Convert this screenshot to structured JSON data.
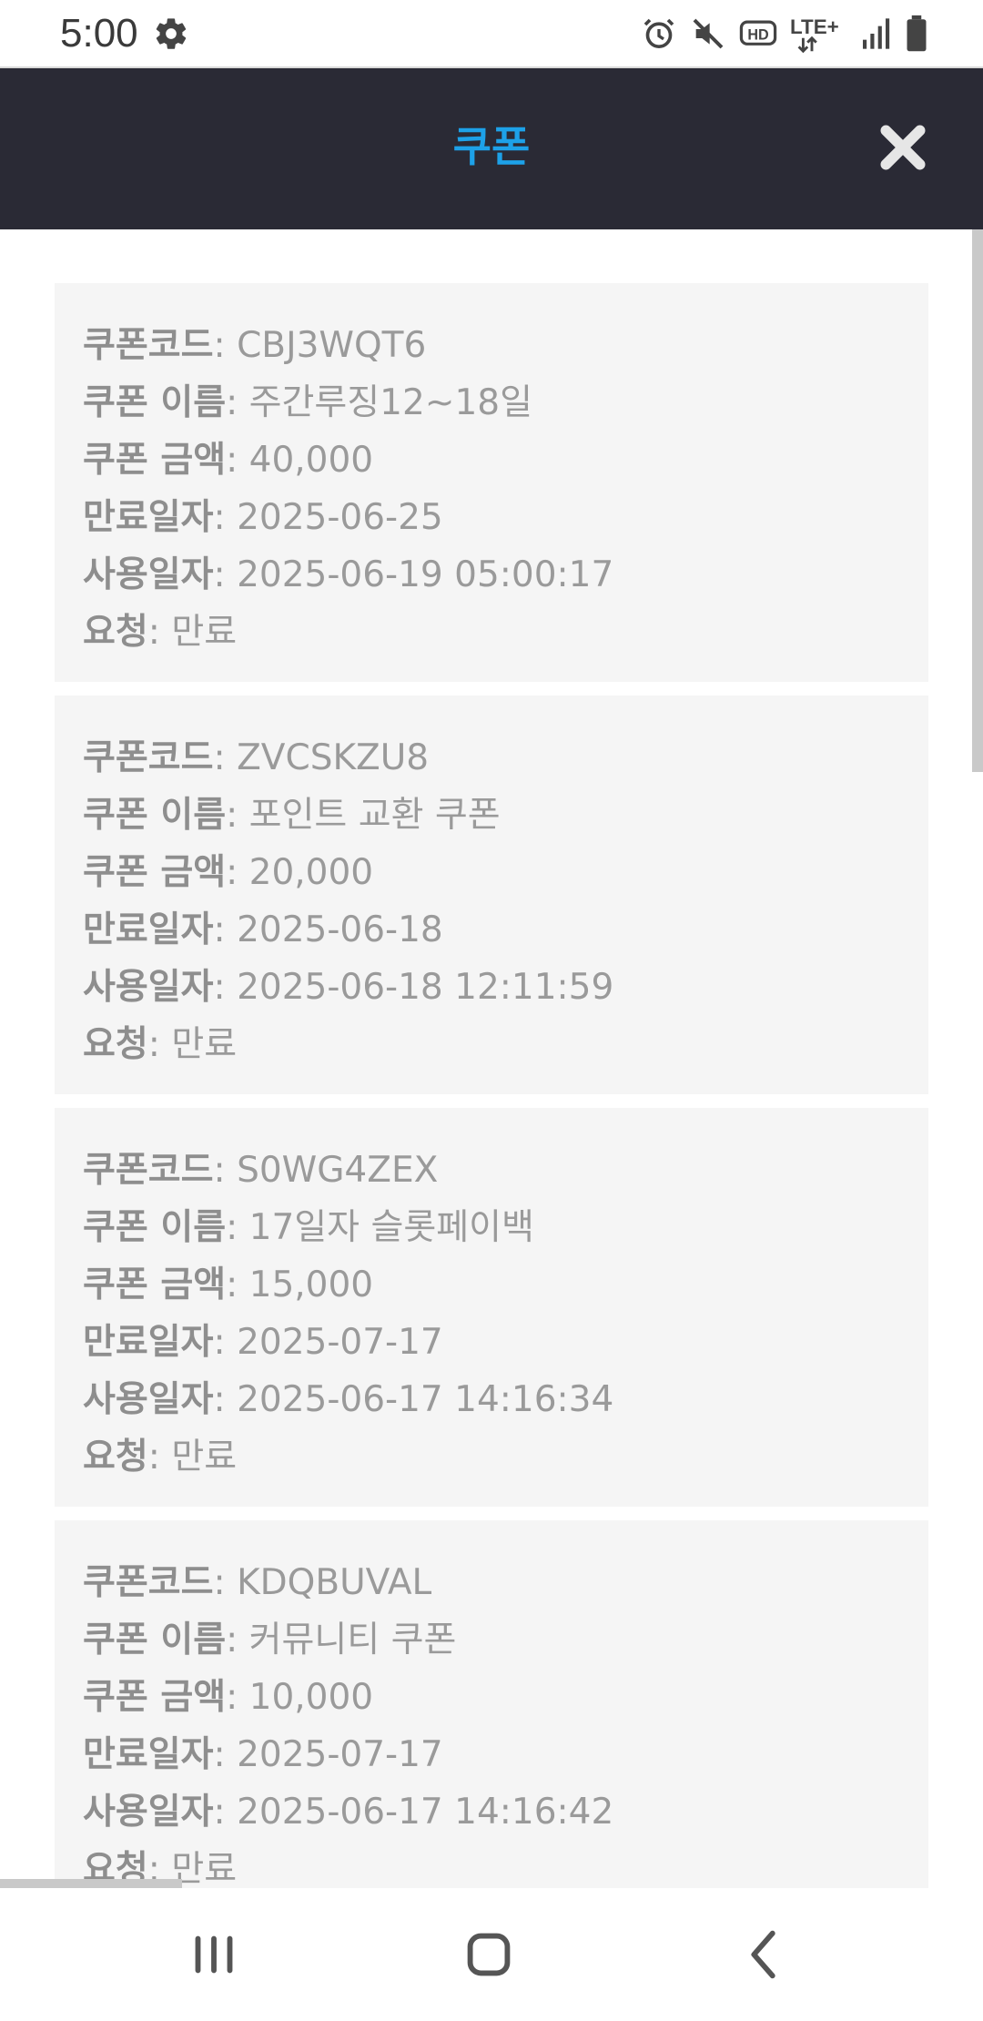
{
  "status_bar": {
    "time": "5:00",
    "icons": [
      "gear-icon",
      "alarm-icon",
      "mute-icon",
      "hd-icon",
      "lte-plus-icon",
      "signal-icon",
      "battery-icon"
    ],
    "lte_label": "LTE+",
    "hd_label": "HD"
  },
  "header": {
    "title": "쿠폰",
    "close_icon": "close-icon",
    "title_color": "#1da1e8",
    "background": "#2a2a35"
  },
  "labels": {
    "code": "쿠폰코드",
    "name": "쿠폰 이름",
    "amount": "쿠폰 금액",
    "expiry": "만료일자",
    "used": "사용일자",
    "request": "요청"
  },
  "coupons": [
    {
      "code": "CBJ3WQT6",
      "name": "주간루징12~18일",
      "amount": "40,000",
      "expiry": "2025-06-25",
      "used": "2025-06-19 05:00:17",
      "request": "만료"
    },
    {
      "code": "ZVCSKZU8",
      "name": "포인트 교환 쿠폰",
      "amount": "20,000",
      "expiry": "2025-06-18",
      "used": "2025-06-18 12:11:59",
      "request": "만료"
    },
    {
      "code": "S0WG4ZEX",
      "name": "17일자 슬롯페이백",
      "amount": "15,000",
      "expiry": "2025-07-17",
      "used": "2025-06-17 14:16:34",
      "request": "만료"
    },
    {
      "code": "KDQBUVAL",
      "name": "커뮤니티 쿠폰",
      "amount": "10,000",
      "expiry": "2025-07-17",
      "used": "2025-06-17 14:16:42",
      "request": "만료"
    }
  ],
  "nav": [
    "recent-apps-icon",
    "home-icon",
    "back-icon"
  ]
}
